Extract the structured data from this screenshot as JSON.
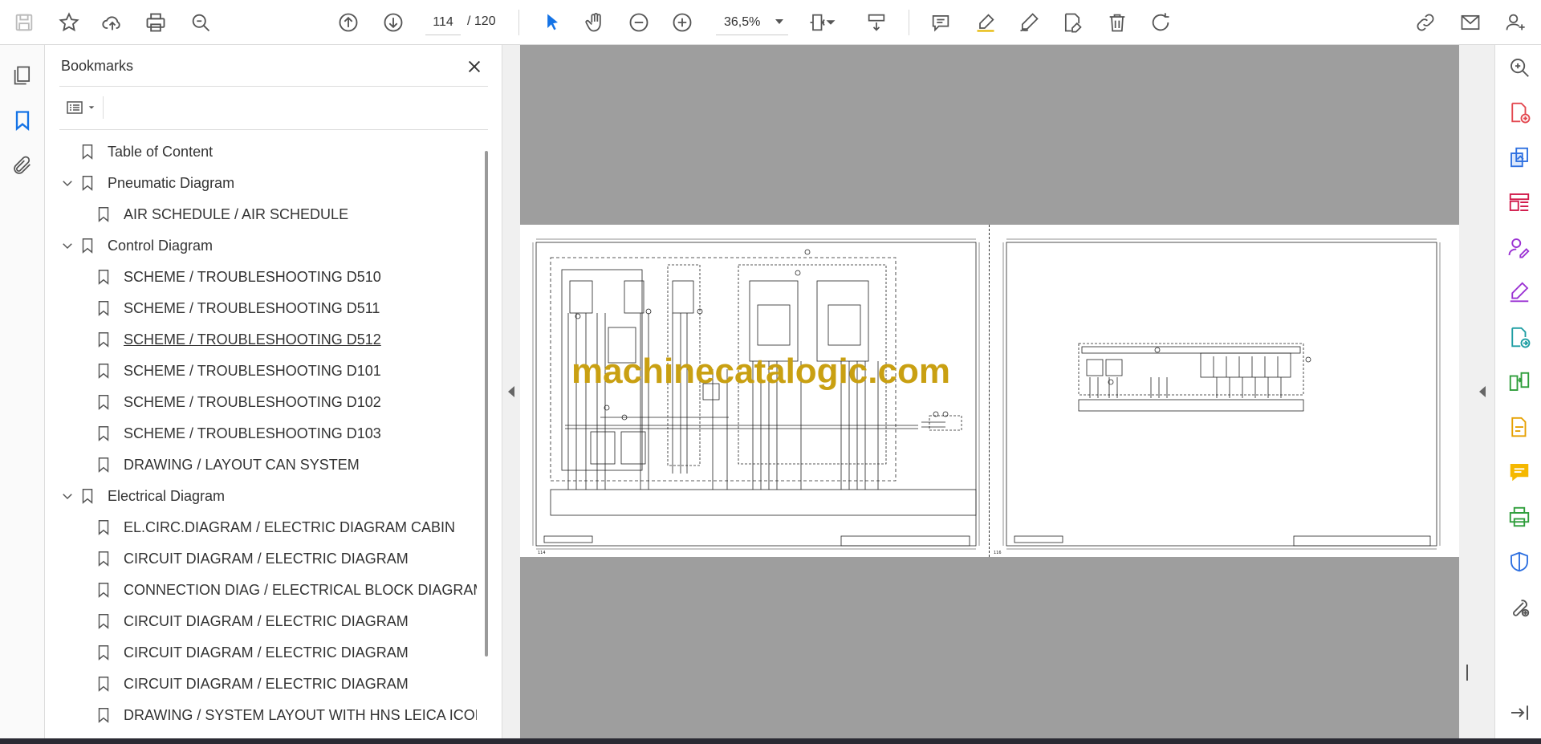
{
  "toolbar": {
    "current_page": "114",
    "total_pages": "/ 120",
    "zoom": "36,5%"
  },
  "panel": {
    "title": "Bookmarks"
  },
  "bookmarks": [
    {
      "label": "Table of Content"
    },
    {
      "label": "Pneumatic Diagram"
    },
    {
      "label": "AIR SCHEDULE / AIR SCHEDULE"
    },
    {
      "label": "Control Diagram"
    },
    {
      "label": "SCHEME / TROUBLESHOOTING D510"
    },
    {
      "label": "SCHEME / TROUBLESHOOTING D511"
    },
    {
      "label": "SCHEME / TROUBLESHOOTING D512"
    },
    {
      "label": "SCHEME / TROUBLESHOOTING D101"
    },
    {
      "label": "SCHEME / TROUBLESHOOTING D102"
    },
    {
      "label": "SCHEME / TROUBLESHOOTING D103"
    },
    {
      "label": "DRAWING / LAYOUT CAN SYSTEM"
    },
    {
      "label": "Electrical Diagram"
    },
    {
      "label": "EL.CIRC.DIAGRAM / ELECTRIC DIAGRAM CABIN"
    },
    {
      "label": "CIRCUIT DIAGRAM / ELECTRIC DIAGRAM"
    },
    {
      "label": "CONNECTION DIAG / ELECTRICAL BLOCK DIAGRAM"
    },
    {
      "label": "CIRCUIT DIAGRAM / ELECTRIC DIAGRAM"
    },
    {
      "label": "CIRCUIT DIAGRAM / ELECTRIC DIAGRAM"
    },
    {
      "label": "CIRCUIT DIAGRAM / ELECTRIC DIAGRAM"
    },
    {
      "label": "DRAWING / SYSTEM LAYOUT WITH HNS LEICA ICON"
    }
  ],
  "document": {
    "watermark": "machinecatalogic.com",
    "page_a_number": "114",
    "page_b_number": "116"
  },
  "colors": {
    "accent": "#1473e6",
    "watermark": "#c9a012",
    "canvas": "#9e9e9e"
  }
}
